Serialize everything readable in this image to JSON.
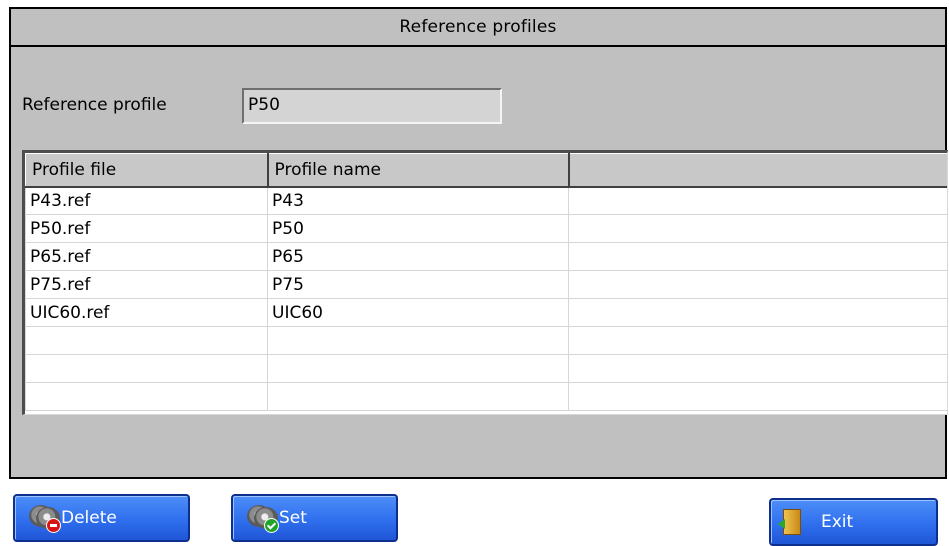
{
  "window": {
    "title": "Reference profiles"
  },
  "reference_profile": {
    "label": "Reference profile",
    "value": "P50"
  },
  "table": {
    "columns": [
      "Profile file",
      "Profile name",
      ""
    ],
    "rows": [
      [
        "P43.ref",
        "P43",
        ""
      ],
      [
        "P50.ref",
        "P50",
        ""
      ],
      [
        "P65.ref",
        "P65",
        ""
      ],
      [
        "P75.ref",
        "P75",
        ""
      ],
      [
        "UIC60.ref",
        "UIC60",
        ""
      ],
      [
        "",
        "",
        ""
      ],
      [
        "",
        "",
        ""
      ],
      [
        "",
        "",
        ""
      ]
    ]
  },
  "buttons": {
    "delete": {
      "label": "Delete",
      "icon": "disc-delete-icon"
    },
    "set": {
      "label": "Set",
      "icon": "disc-check-icon"
    },
    "exit": {
      "label": "Exit",
      "icon": "exit-door-icon"
    }
  },
  "colors": {
    "window_bg": "#c0c0c0",
    "button_blue": "#2f6fee"
  }
}
